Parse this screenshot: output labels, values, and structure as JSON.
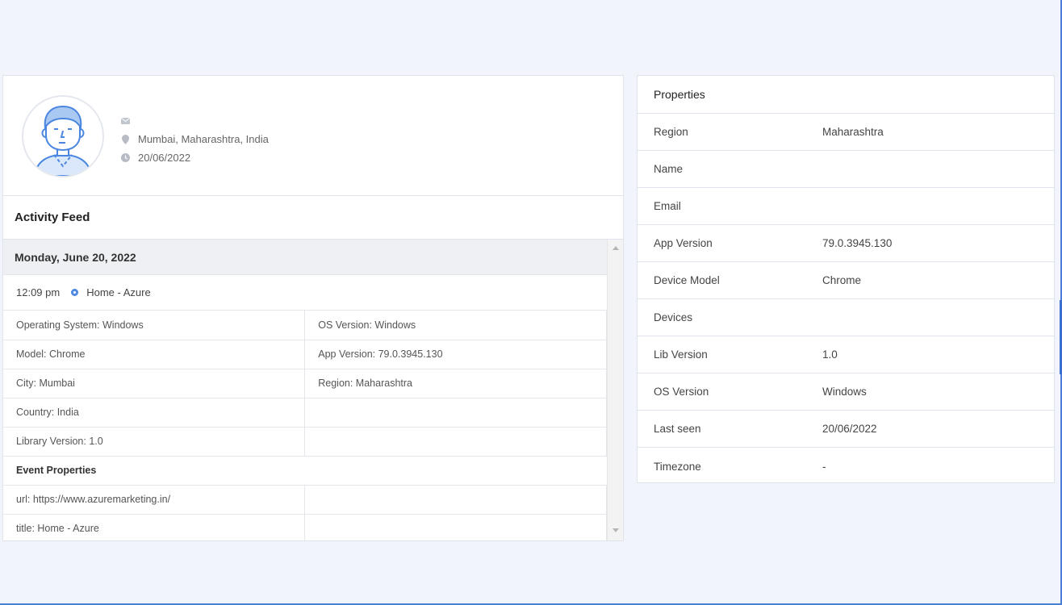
{
  "profile": {
    "email": "",
    "location": "Mumbai, Maharashtra, India",
    "date": "20/06/2022"
  },
  "feed": {
    "title": "Activity Feed",
    "day": "Monday, June 20, 2022",
    "event": {
      "time": "12:09 pm",
      "name": "Home - Azure"
    },
    "rows": [
      [
        "Operating System: Windows",
        "OS Version: Windows"
      ],
      [
        "Model: Chrome",
        "App Version: 79.0.3945.130"
      ],
      [
        "City: Mumbai",
        "Region: Maharashtra"
      ],
      [
        "Country: India",
        ""
      ],
      [
        "Library Version: 1.0",
        ""
      ]
    ],
    "event_properties_label": "Event Properties",
    "event_rows": [
      [
        "url: https://www.azuremarketing.in/",
        ""
      ],
      [
        "title: Home - Azure",
        ""
      ]
    ]
  },
  "properties": {
    "title": "Properties",
    "rows": [
      {
        "key": "Region",
        "value": "Maharashtra"
      },
      {
        "key": "Name",
        "value": ""
      },
      {
        "key": "Email",
        "value": ""
      },
      {
        "key": "App Version",
        "value": "79.0.3945.130"
      },
      {
        "key": "Device Model",
        "value": "Chrome"
      },
      {
        "key": "Devices",
        "value": ""
      },
      {
        "key": "Lib Version",
        "value": "1.0"
      },
      {
        "key": "OS Version",
        "value": "Windows"
      },
      {
        "key": "Last seen",
        "value": "20/06/2022"
      },
      {
        "key": "Timezone",
        "value": "-"
      }
    ]
  },
  "colors": {
    "accent": "#4a86e0",
    "frame": "#4a7fd4",
    "background": "#f1f4fa"
  }
}
